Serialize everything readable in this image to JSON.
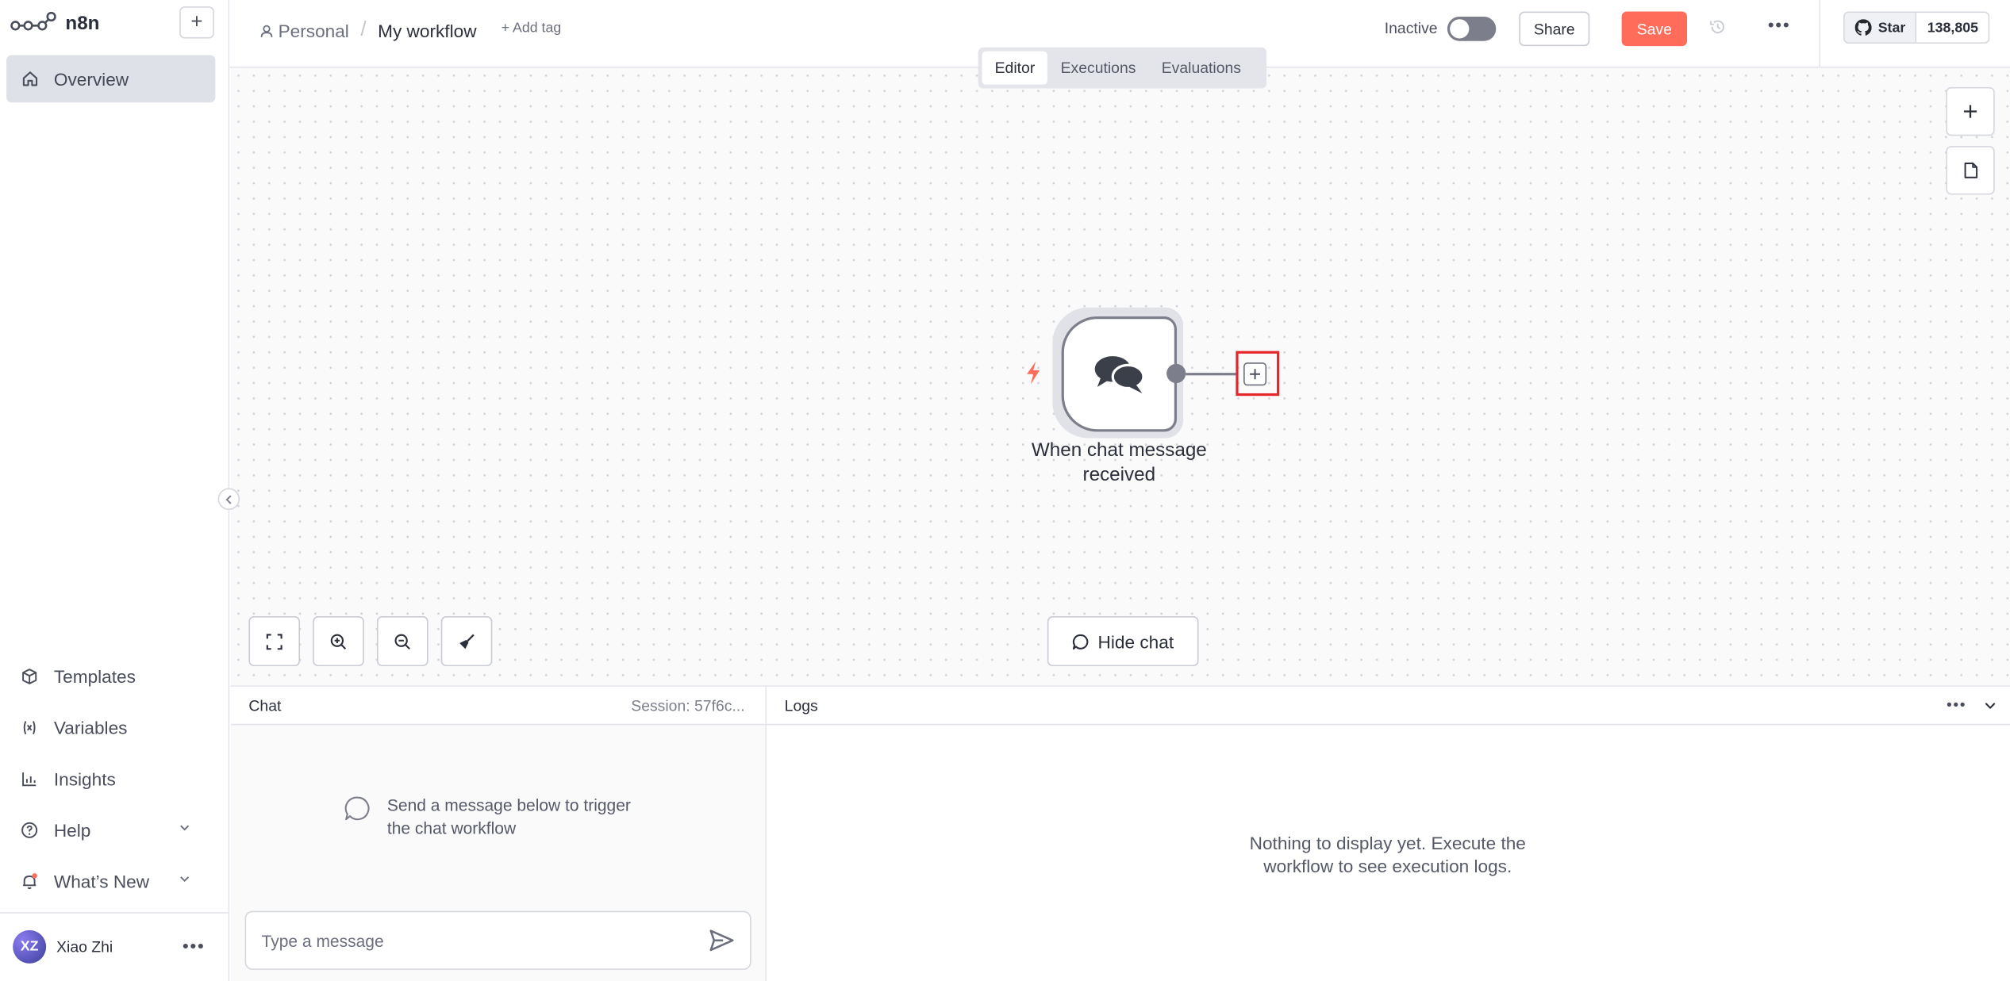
{
  "app": {
    "logo_text": "n8n"
  },
  "sidebar": {
    "overview_label": "Overview",
    "items": [
      {
        "label": "Templates",
        "icon": "box-icon"
      },
      {
        "label": "Variables",
        "icon": "variable-icon"
      },
      {
        "label": "Insights",
        "icon": "chart-icon"
      },
      {
        "label": "Help",
        "icon": "help-icon"
      },
      {
        "label": "What’s New",
        "icon": "bell-icon"
      }
    ],
    "user": {
      "initials": "XZ",
      "name": "Xiao Zhi"
    }
  },
  "header": {
    "breadcrumb_project": "Personal",
    "workflow_name": "My workflow",
    "add_tag": "+ Add tag",
    "status_label": "Inactive",
    "active": false,
    "share_label": "Share",
    "save_label": "Save",
    "github_star_label": "Star",
    "github_star_count": "138,805"
  },
  "canvas": {
    "tabs": [
      {
        "label": "Editor",
        "active": true
      },
      {
        "label": "Executions",
        "active": false
      },
      {
        "label": "Evaluations",
        "active": false
      }
    ],
    "node": {
      "label": "When chat message received",
      "icon": "chat-bubbles-icon"
    },
    "hide_chat_label": "Hide chat"
  },
  "chat": {
    "title": "Chat",
    "session": "Session: 57f6c...",
    "empty_text": "Send a message below to trigger the chat workflow",
    "input_placeholder": "Type a message"
  },
  "logs": {
    "title": "Logs",
    "empty_text": "Nothing to display yet. Execute the workflow to see execution logs."
  },
  "colors": {
    "accent": "#ff6d5a",
    "highlight": "#e5262a"
  }
}
